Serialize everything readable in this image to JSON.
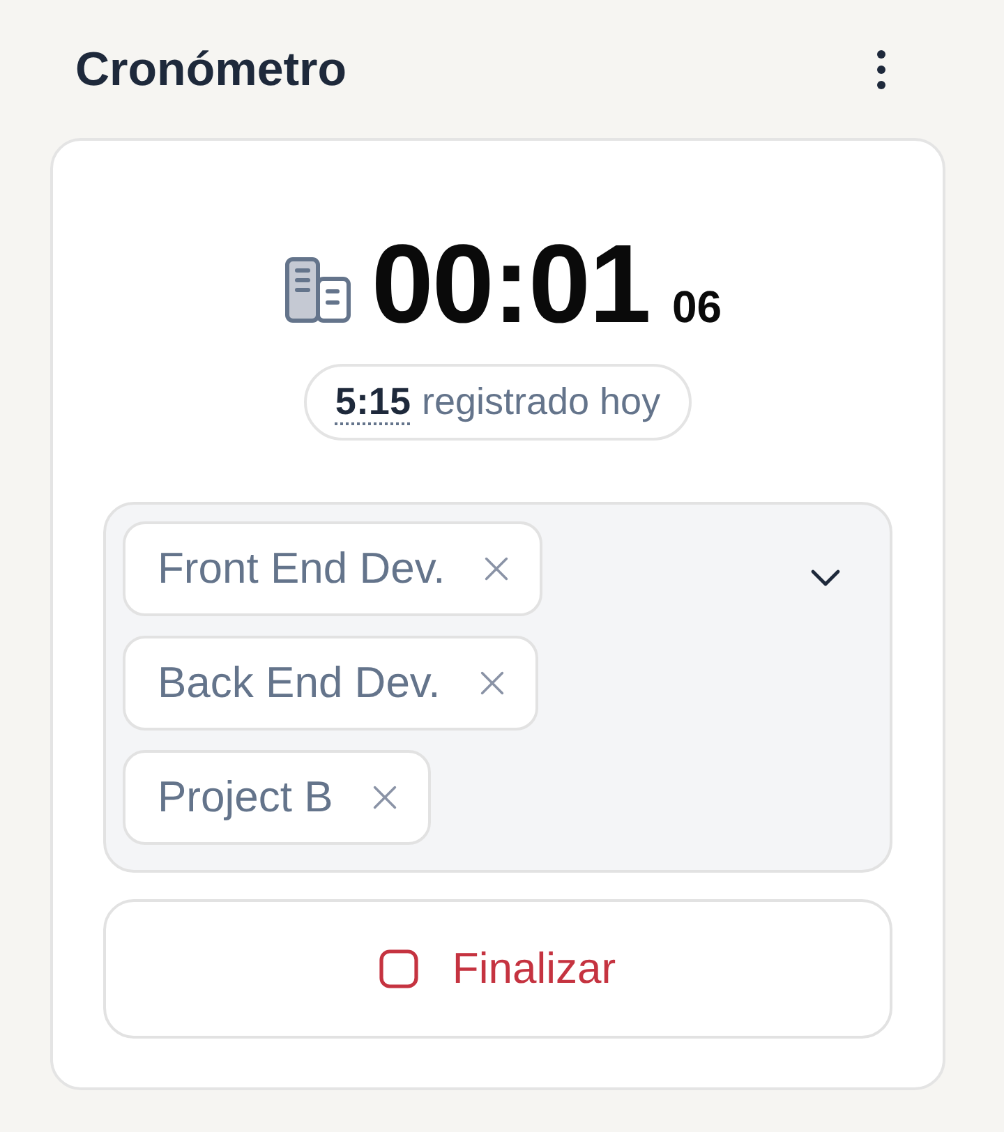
{
  "header": {
    "title": "Cronómetro"
  },
  "timer": {
    "main": "00:01",
    "small": "06"
  },
  "logged_today": {
    "value": "5:15",
    "label": "registrado hoy"
  },
  "tags": [
    {
      "label": "Front End Dev."
    },
    {
      "label": "Back End Dev."
    },
    {
      "label": "Project B"
    }
  ],
  "stop_button": {
    "label": "Finalizar"
  }
}
